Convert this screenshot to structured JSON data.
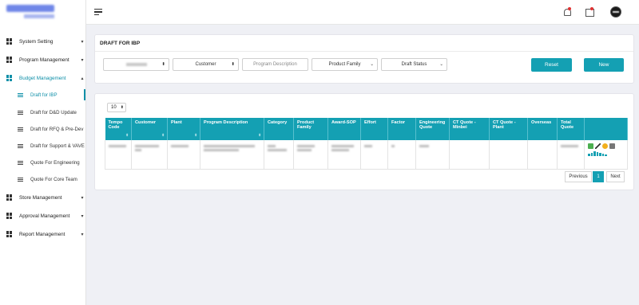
{
  "sidebar": {
    "items": [
      {
        "label": "System Setting"
      },
      {
        "label": "Program Management"
      },
      {
        "label": "Budget Management"
      },
      {
        "label": "Store Management"
      },
      {
        "label": "Approval Management"
      },
      {
        "label": "Report Management"
      }
    ],
    "sub_items": [
      {
        "label": "Draft for IBP"
      },
      {
        "label": "Draft for D&D Update"
      },
      {
        "label": "Draft for RFQ & Pre-Dev"
      },
      {
        "label": "Draft for Support & VAVE"
      },
      {
        "label": "Quote For Engineering"
      },
      {
        "label": "Quote For Core Team"
      }
    ]
  },
  "page": {
    "title": "DRAFT FOR IBP"
  },
  "filters": {
    "customer": "Customer",
    "program_description_placeholder": "Program Description",
    "product_family": "Product Family",
    "draft_status": "Draft Status",
    "reset_label": "Reset",
    "new_label": "New"
  },
  "table": {
    "page_length": "10",
    "columns": [
      "Tempo Code",
      "Customer",
      "Plant",
      "Program Description",
      "Category",
      "Product Family",
      "Award-SOP",
      "Effort",
      "Factor",
      "Engineering Quote",
      "CT Quote - Minbei",
      "CT Quote - Plant",
      "Overseas",
      "Total Quote",
      ""
    ]
  },
  "pagination": {
    "previous": "Previous",
    "current": "1",
    "next": "Next"
  },
  "colors": {
    "accent": "#14a0b3",
    "notification_dot": "#e03030"
  }
}
